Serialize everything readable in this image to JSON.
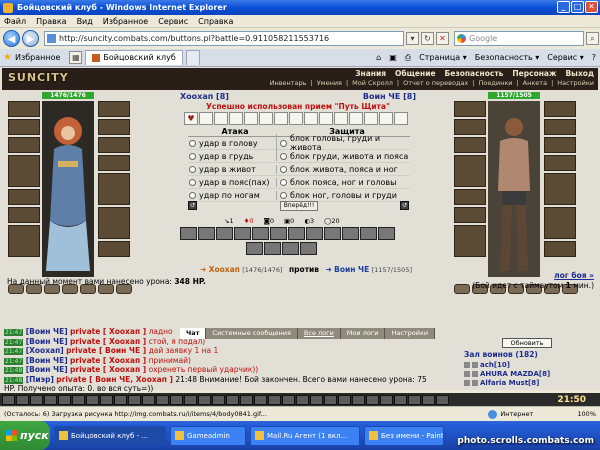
{
  "window": {
    "title": "Бойцовский клуб - Windows Internet Explorer"
  },
  "menu": [
    "Файл",
    "Правка",
    "Вид",
    "Избранное",
    "Сервис",
    "Справка"
  ],
  "address": {
    "url": "http://suncity.combats.com/buttons.pl?battle=0.911058211553716",
    "search_placeholder": "Google"
  },
  "favorites_label": "Избранное",
  "tab": {
    "label": "Бойцовский клуб"
  },
  "commands": [
    "Страница ▾",
    "Безопасность ▾",
    "Сервис ▾"
  ],
  "game": {
    "logo": "SUNCITY",
    "top_menu": [
      "Знания",
      "Общение",
      "Безопасность",
      "Персонаж",
      "Выход"
    ],
    "sub_menu": [
      "Инвентарь",
      "Умения",
      "Мой Скролл",
      "Отчет о переводах",
      "Поединки",
      "Анкета",
      "Настройки"
    ]
  },
  "player1": {
    "name": "Хоохап [8]",
    "hp": "1476/1476"
  },
  "player2": {
    "name": "Воин ЧЕ [8]",
    "hp": "1157/1505"
  },
  "success_msg": "Успешно использован прием \"Путь Щита\"",
  "attack": {
    "header": "Атака",
    "options": [
      "удар в голову",
      "удар в грудь",
      "удар в живот",
      "удар в пояс(пах)",
      "удар по ногам"
    ]
  },
  "defense": {
    "header": "Защита",
    "options": [
      "блок головы, груди и живота",
      "блок груди, живота и пояса",
      "блок живота, пояса и ног",
      "блок пояса, ног и головы",
      "блок ног, головы и груди"
    ]
  },
  "forward_button": "Вперёд!!!",
  "stats": [
    "1",
    "0",
    "0",
    "0",
    "3",
    "20"
  ],
  "vs": {
    "p1": "Хоохап",
    "p1hp": "[1476/1476]",
    "word": "против",
    "p2": "Воин ЧЕ",
    "p2hp": "[1157/1505]"
  },
  "damage_text": "На данный момент вами нанесено урона:",
  "damage_value": "348 HP.",
  "battle_log": {
    "link": "лог боя »",
    "timeout_pre": "(Бой идет с таймаутом",
    "timeout_val": "1",
    "timeout_post": "мин.)"
  },
  "chat_tabs": [
    "Чат",
    "Системные сообщения",
    "Все логи",
    "Мои логи",
    "Настройки"
  ],
  "chat": [
    {
      "time": "21:47",
      "nick": "[Воин ЧЕ]",
      "priv": "private [ Хоохап ]",
      "msg": "ладно"
    },
    {
      "time": "21:47",
      "nick": "[Воин ЧЕ]",
      "priv": "private [ Хоохап ]",
      "msg": "стой, я подал)"
    },
    {
      "time": "21:47",
      "nick": "[Хоохап]",
      "priv": "private [ Воин ЧЕ ]",
      "msg": "дай заявку 1 на 1"
    },
    {
      "time": "21:47",
      "nick": "[Воин ЧЕ]",
      "priv": "private [ Хоохап ]",
      "msg": "принимай)"
    },
    {
      "time": "21:48",
      "nick": "[Воин ЧЕ]",
      "priv": "private [ Хоохап ]",
      "msg": "охренеть первый ударчик))"
    },
    {
      "time": "21:48",
      "nick": "[Пиэр]",
      "priv": "private [ Воин ЧЕ, Хоохап ]",
      "msg": "21:48 Внимание! Бой закончен. Всего вами нанесено урона: 75"
    },
    {
      "time": "",
      "nick": "",
      "priv": "",
      "msg": "HP. Получено опыта: 0. во вся суть=))"
    }
  ],
  "right_panel": {
    "refresh": "Обновить",
    "hall": "Зал воинов (182)",
    "players": [
      "ach[10]",
      "AHURA MAZDA[8]",
      "Alfaria Must[8]"
    ]
  },
  "clock": "21:50",
  "statusbar": {
    "text": "(Осталось: 6) Загрузка рисунка http://img.combats.ru/i/items/4/body0841.gif...",
    "zone": "Интернет",
    "zoom": "100%"
  },
  "taskbar": {
    "start": "пуск",
    "tasks": [
      "Бойцовский клуб - ...",
      "Gameadmin",
      "Mail.Ru Агент (1 вкл...",
      "Без имени - Paint"
    ]
  },
  "watermark": "photo.scrolls.combats.com"
}
